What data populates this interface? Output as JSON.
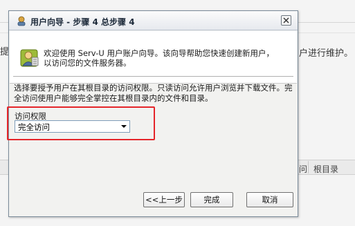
{
  "background_app": {
    "right_text": "户进行维护。",
    "left_text": "提",
    "column_a": "问",
    "column_b": "根目录"
  },
  "dialog": {
    "title": "用户向导 - 步骤 4 总步骤 4",
    "intro": "欢迎使用 Serv-U 用户账户向导。该向导帮助您快速创建新用户，以访问您的文件服务器。",
    "description": "选择要授予用户在其根目录的访问权限。只读访问允许用户浏览并下载文件。完全访问使用户能够完全掌控在其根目录内的文件和目录。",
    "access_label": "访问权限",
    "access_value": "完全访问",
    "buttons": {
      "back": "<<上一步",
      "finish": "完成",
      "cancel": "取消"
    }
  },
  "colors": {
    "highlight": "#e5252a",
    "title_text": "#1d2a3a",
    "window_bg": "#f2f2f0"
  },
  "icons": [
    "wizard-app-icon",
    "close-icon",
    "user-wizard-icon",
    "dropdown-arrow-icon"
  ]
}
